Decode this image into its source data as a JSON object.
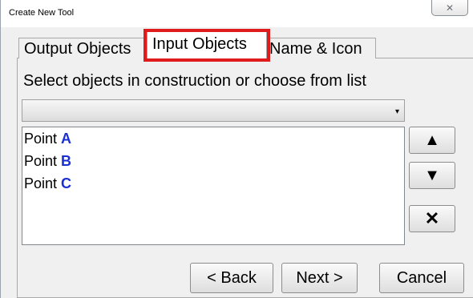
{
  "window": {
    "title": "Create New Tool",
    "close_glyph": "✕"
  },
  "tabs": [
    {
      "label": "Output Objects",
      "selected": false
    },
    {
      "label": "Input Objects",
      "selected": true
    },
    {
      "label": "Name & Icon",
      "selected": false
    }
  ],
  "instruction": "Select objects in construction or choose from list",
  "dropdown": {
    "value": "",
    "arrow_glyph": "▾"
  },
  "input_list": [
    {
      "prefix": "Point",
      "name": "A"
    },
    {
      "prefix": "Point",
      "name": "B"
    },
    {
      "prefix": "Point",
      "name": "C"
    }
  ],
  "side_buttons": {
    "move_up": "▲",
    "move_down": "▼",
    "remove": "✕"
  },
  "buttons": {
    "back": "< Back",
    "next": "Next >",
    "cancel": "Cancel"
  },
  "colors": {
    "highlight": "#e01b1b",
    "object_name": "#1a2fd4"
  }
}
